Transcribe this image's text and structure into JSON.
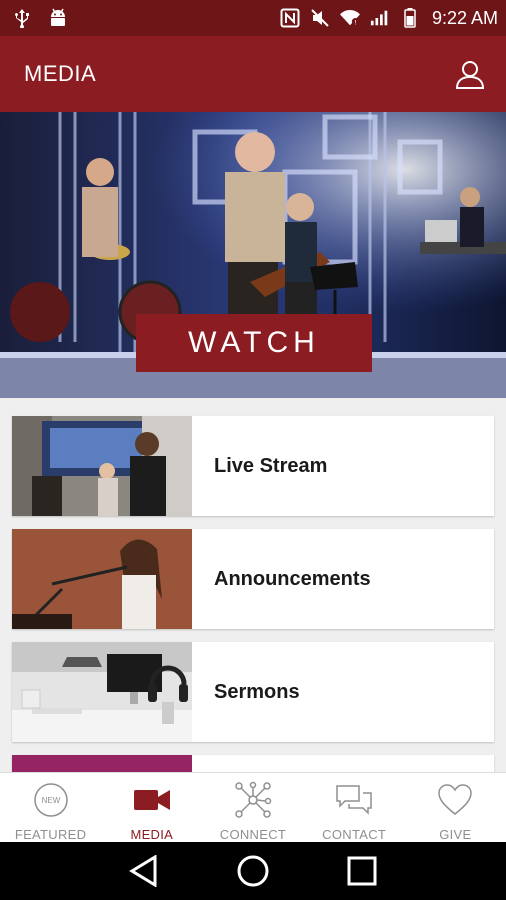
{
  "status_bar": {
    "time": "9:22 AM",
    "left_icons": [
      "usb-icon",
      "android-icon"
    ],
    "right_icons": [
      "nfc-icon",
      "mute-icon",
      "wifi-icon",
      "signal-icon",
      "battery-icon"
    ]
  },
  "app_bar": {
    "title": "MEDIA",
    "profile_icon": "user-icon"
  },
  "hero": {
    "button_label": "WATCH"
  },
  "media_list": [
    {
      "label": "Live Stream"
    },
    {
      "label": "Announcements"
    },
    {
      "label": "Sermons"
    }
  ],
  "tabs": [
    {
      "label": "FEATURED",
      "icon": "new-badge-icon",
      "active": false
    },
    {
      "label": "MEDIA",
      "icon": "video-camera-icon",
      "active": true
    },
    {
      "label": "CONNECT",
      "icon": "network-icon",
      "active": false
    },
    {
      "label": "CONTACT",
      "icon": "chat-bubbles-icon",
      "active": false
    },
    {
      "label": "GIVE",
      "icon": "heart-icon",
      "active": false
    }
  ],
  "new_badge_text": "NEW",
  "colors": {
    "status_bar": "#6e1518",
    "app_bar": "#8b1c21",
    "accent": "#8b1c21",
    "tab_inactive": "#8f8f8f"
  }
}
